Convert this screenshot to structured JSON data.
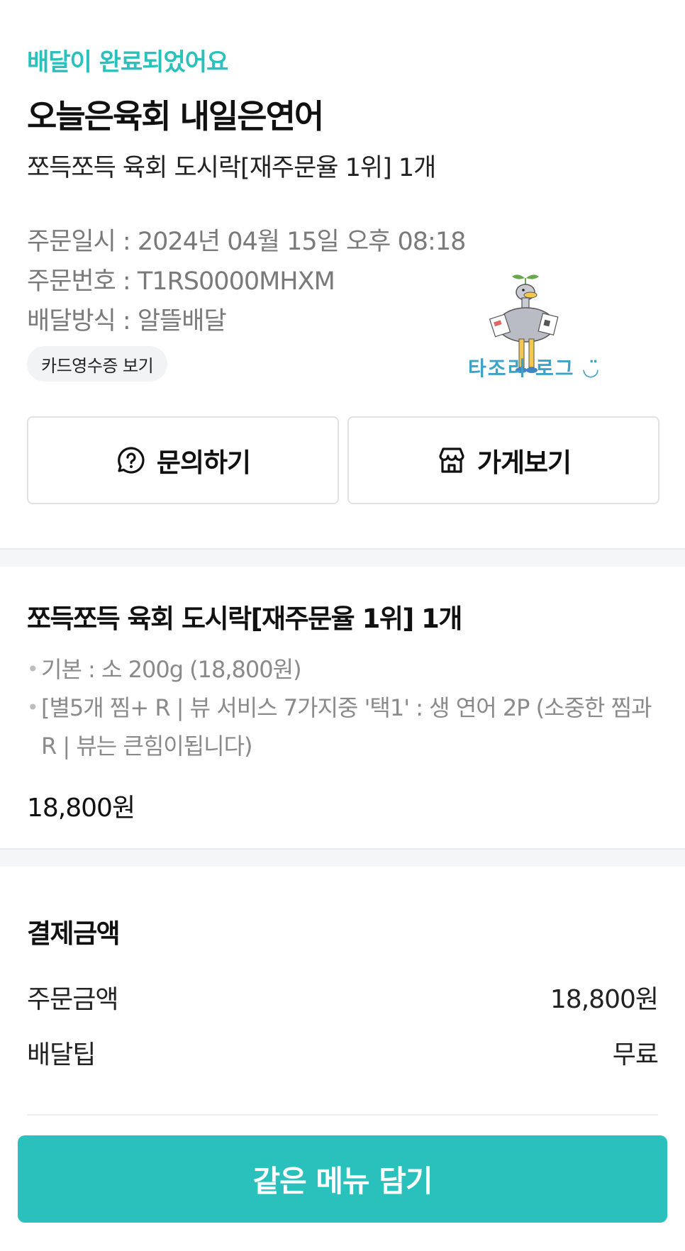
{
  "colors": {
    "accent": "#2ac1bc",
    "muted_text": "#7a7a7a",
    "chip_bg": "#f2f3f5",
    "divider": "#f5f6f7"
  },
  "order": {
    "status": "배달이 완료되었어요",
    "store_name": "오늘은육회 내일은연어",
    "summary": "쪼득쪼득 육회 도시락[재주문율 1위] 1개",
    "date_line": "주문일시 : 2024년 04월 15일 오후 08:18",
    "number_line": "주문번호 : T1RS0000MHXM",
    "method_line": "배달방식 : 알뜰배달",
    "receipt_button": "카드영수증 보기"
  },
  "mascot": {
    "icon": "ostrich-mascot-icon",
    "caption": "타조리 로그 ◡̈"
  },
  "actions": {
    "inquiry_label": "문의하기",
    "inquiry_icon": "question-chat-icon",
    "store_label": "가게보기",
    "store_icon": "storefront-icon"
  },
  "menu": {
    "title": "쪼득쪼득 육회 도시락[재주문율 1위] 1개",
    "options": [
      "기본 : 소 200g (18,800원)",
      "[별5개 찜+ R | 뷰 서비스 7가지중 '택1' : 생 연어 2P (소중한 찜과 R | 뷰는 큰힘이됩니다)"
    ],
    "price": "18,800원"
  },
  "payment": {
    "title": "결제금액",
    "rows": [
      {
        "label": "주문금액",
        "value": "18,800원"
      },
      {
        "label": "배달팁",
        "value": "무료"
      }
    ]
  },
  "cta": {
    "label": "같은 메뉴 담기"
  }
}
